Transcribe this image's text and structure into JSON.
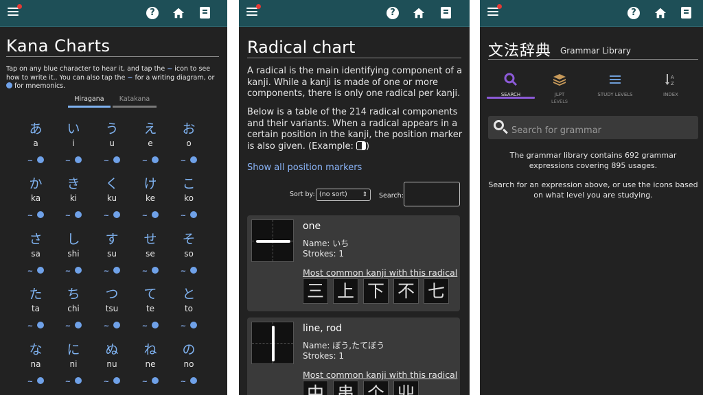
{
  "kana": {
    "title": "Kana Charts",
    "intro_a": "Tap on any blue character to hear it, and tap the",
    "intro_b": "icon to see how to write it.. You can also tap the",
    "intro_c": "for a writing diagram, or",
    "intro_d": "for mnemonics.",
    "tabs": [
      {
        "label": "Hiragana",
        "active": true
      },
      {
        "label": "Katakana",
        "active": false
      }
    ],
    "rows": [
      [
        {
          "k": "あ",
          "r": "a"
        },
        {
          "k": "い",
          "r": "i"
        },
        {
          "k": "う",
          "r": "u"
        },
        {
          "k": "え",
          "r": "e"
        },
        {
          "k": "お",
          "r": "o"
        }
      ],
      [
        {
          "k": "か",
          "r": "ka"
        },
        {
          "k": "き",
          "r": "ki"
        },
        {
          "k": "く",
          "r": "ku"
        },
        {
          "k": "け",
          "r": "ke"
        },
        {
          "k": "こ",
          "r": "ko"
        }
      ],
      [
        {
          "k": "さ",
          "r": "sa"
        },
        {
          "k": "し",
          "r": "shi"
        },
        {
          "k": "す",
          "r": "su"
        },
        {
          "k": "せ",
          "r": "se"
        },
        {
          "k": "そ",
          "r": "so"
        }
      ],
      [
        {
          "k": "た",
          "r": "ta"
        },
        {
          "k": "ち",
          "r": "chi"
        },
        {
          "k": "つ",
          "r": "tsu"
        },
        {
          "k": "て",
          "r": "te"
        },
        {
          "k": "と",
          "r": "to"
        }
      ],
      [
        {
          "k": "な",
          "r": "na"
        },
        {
          "k": "に",
          "r": "ni"
        },
        {
          "k": "ぬ",
          "r": "nu"
        },
        {
          "k": "ね",
          "r": "ne"
        },
        {
          "k": "の",
          "r": "no"
        }
      ]
    ]
  },
  "radical": {
    "title": "Radical chart",
    "para1": "A radical is the main identifying component of a kanji. While a kanji is made of one or more components, there is only one radical per kanji.",
    "para2": "Below is a table of the 214 radical components and their variants. When a radical appears in a certain position in the kanji, the position marker is also given. (Example:",
    "para2_end": ")",
    "show_all": "Show all position markers",
    "sort_label": "Sort by:",
    "sort_value": "(no sort)",
    "search_label": "Search:",
    "cards": [
      {
        "name": "one",
        "name_line": "Name: いち",
        "strokes_line": "Strokes: 1",
        "common": "Most common kanji with this radical",
        "kanji": [
          "三",
          "上",
          "下",
          "不",
          "七"
        ]
      },
      {
        "name": "line, rod",
        "name_line": "Name: ぼう,たてぼう",
        "strokes_line": "Strokes: 1",
        "common": "Most common kanji with this radical",
        "kanji": [
          "中",
          "串",
          "个",
          "丱"
        ]
      }
    ]
  },
  "grammar": {
    "title": "文法辞典",
    "subtitle": "Grammar Library",
    "tabs": [
      {
        "label": "Search",
        "label2": "",
        "icon": "search-icon",
        "active": true
      },
      {
        "label": "JLPT",
        "label2": "Levels",
        "icon": "stack-icon",
        "active": false
      },
      {
        "label": "Study Levels",
        "label2": "",
        "icon": "list-icon",
        "active": false
      },
      {
        "label": "Index",
        "label2": "",
        "icon": "sort-az-icon",
        "active": false
      }
    ],
    "search_placeholder": "Search for grammar",
    "info1": "The grammar library contains 692 grammar expressions covering 895 usages.",
    "info2": "Search for an expression above, or use the icons based on what level you are studying."
  },
  "colors": {
    "header_bg": "#1e4f57",
    "background": "#222222",
    "kana_blue": "#7fb2f0",
    "link_blue": "#8ab4f8",
    "active_tab_purple": "#8c5ad8",
    "notification_red": "#e53935"
  }
}
